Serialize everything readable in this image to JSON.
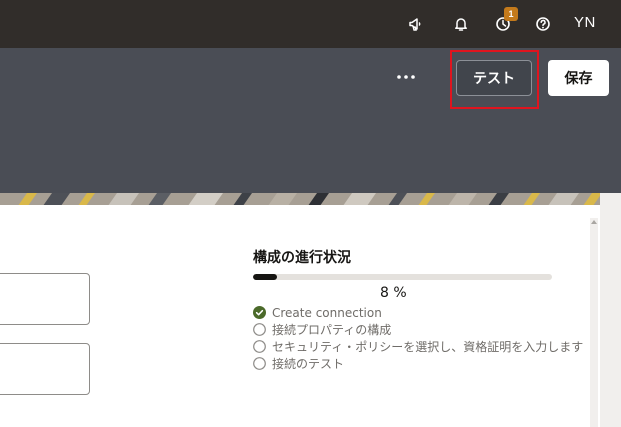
{
  "header": {
    "notification_badge": "1",
    "user_initials": "YN",
    "icons": [
      "megaphone-icon",
      "bell-icon",
      "clock-icon",
      "help-icon"
    ]
  },
  "toolbar": {
    "more_label": "•••",
    "test_label": "テスト",
    "save_label": "保存"
  },
  "progress": {
    "title": "構成の進行状況",
    "percent_text": "8 %",
    "fraction": 0.08,
    "steps": [
      {
        "label": "Create connection",
        "status": "complete"
      },
      {
        "label": "接続プロパティの構成",
        "status": "pending"
      },
      {
        "label": "セキュリティ・ポリシーを選択し、資格証明を入力します",
        "status": "pending"
      },
      {
        "label": "接続のテスト",
        "status": "pending"
      }
    ]
  },
  "colors": {
    "topbar": "#312d2a",
    "subheader": "#4a4d55",
    "highlight": "#e0141e",
    "check": "#4b6a2a",
    "badge": "#c47a1b"
  }
}
